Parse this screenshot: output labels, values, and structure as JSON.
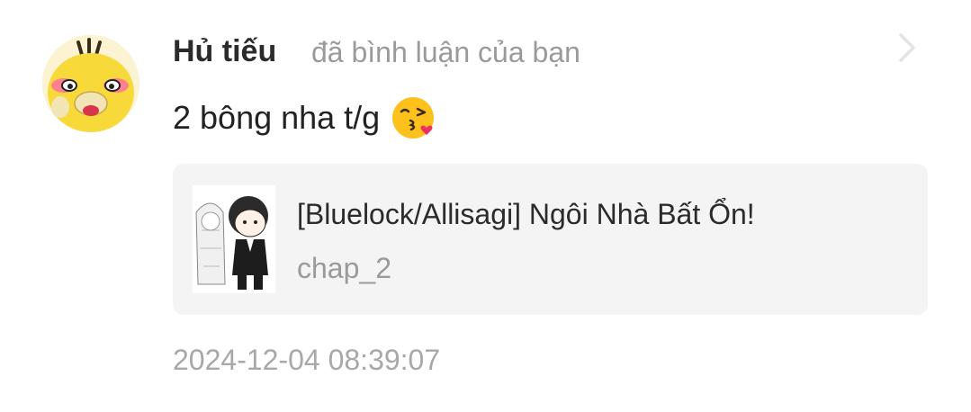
{
  "comment": {
    "username": "Hủ tiếu",
    "action_text": "đã bình luận của bạn",
    "text": "2 bông nha t/g",
    "emoji": "kissing-face-emoji",
    "timestamp": "2024-12-04 08:39:07"
  },
  "story_card": {
    "title": "[Bluelock/Allisagi] Ngôi Nhà Bất Ổn!",
    "chapter": "chap_2"
  },
  "icons": {
    "navigate": "chevron-right-icon",
    "avatar": "duck-avatar-image"
  },
  "colors": {
    "username": "#2b2b2b",
    "secondary_text": "#9a9a9a",
    "card_background": "#f4f4f4",
    "avatar_yellow": "#f7d93a"
  }
}
